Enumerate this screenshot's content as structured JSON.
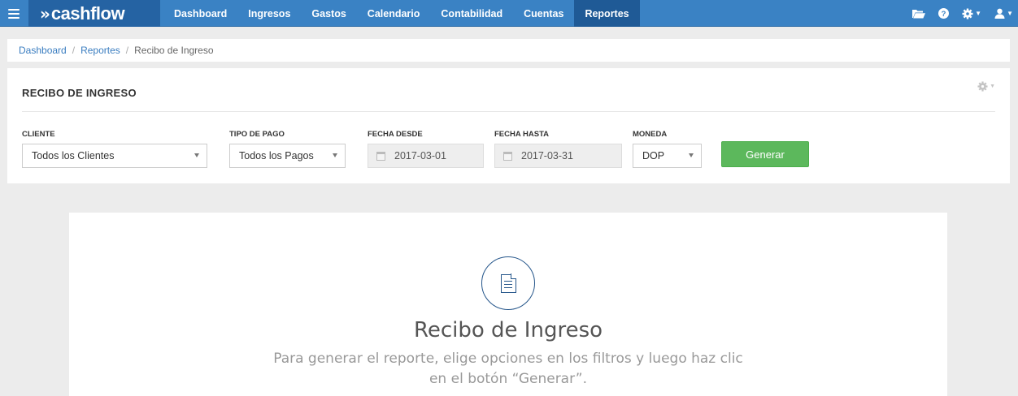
{
  "brand": {
    "name": "cashflow"
  },
  "nav": {
    "items": [
      {
        "label": "Dashboard"
      },
      {
        "label": "Ingresos"
      },
      {
        "label": "Gastos"
      },
      {
        "label": "Calendario"
      },
      {
        "label": "Contabilidad"
      },
      {
        "label": "Cuentas"
      },
      {
        "label": "Reportes",
        "active": true
      }
    ],
    "right_icons": [
      "folder-icon",
      "help-icon",
      "settings-icon",
      "user-icon"
    ]
  },
  "breadcrumb": {
    "items": [
      {
        "label": "Dashboard"
      },
      {
        "label": "Reportes"
      }
    ],
    "current": "Recibo de Ingreso"
  },
  "panel": {
    "title": "RECIBO DE INGRESO",
    "filters": {
      "cliente": {
        "label": "CLIENTE",
        "value": "Todos los Clientes"
      },
      "tipo_pago": {
        "label": "TIPO DE PAGO",
        "value": "Todos los Pagos"
      },
      "fecha_desde": {
        "label": "FECHA DESDE",
        "value": "2017-03-01"
      },
      "fecha_hasta": {
        "label": "FECHA HASTA",
        "value": "2017-03-31"
      },
      "moneda": {
        "label": "MONEDA",
        "value": "DOP"
      }
    },
    "generate_label": "Generar"
  },
  "empty_state": {
    "icon": "document-icon",
    "title": "Recibo de Ingreso",
    "description": "Para generar el reporte, elige opciones en los filtros y luego haz clic en el botón “Generar”."
  },
  "colors": {
    "nav_bg": "#3a82c4",
    "brand_bg": "#2563a3",
    "nav_active": "#1f5a96",
    "generate_button": "#5cb85c",
    "link": "#3a7dc0",
    "icon_accent": "#24558a"
  }
}
